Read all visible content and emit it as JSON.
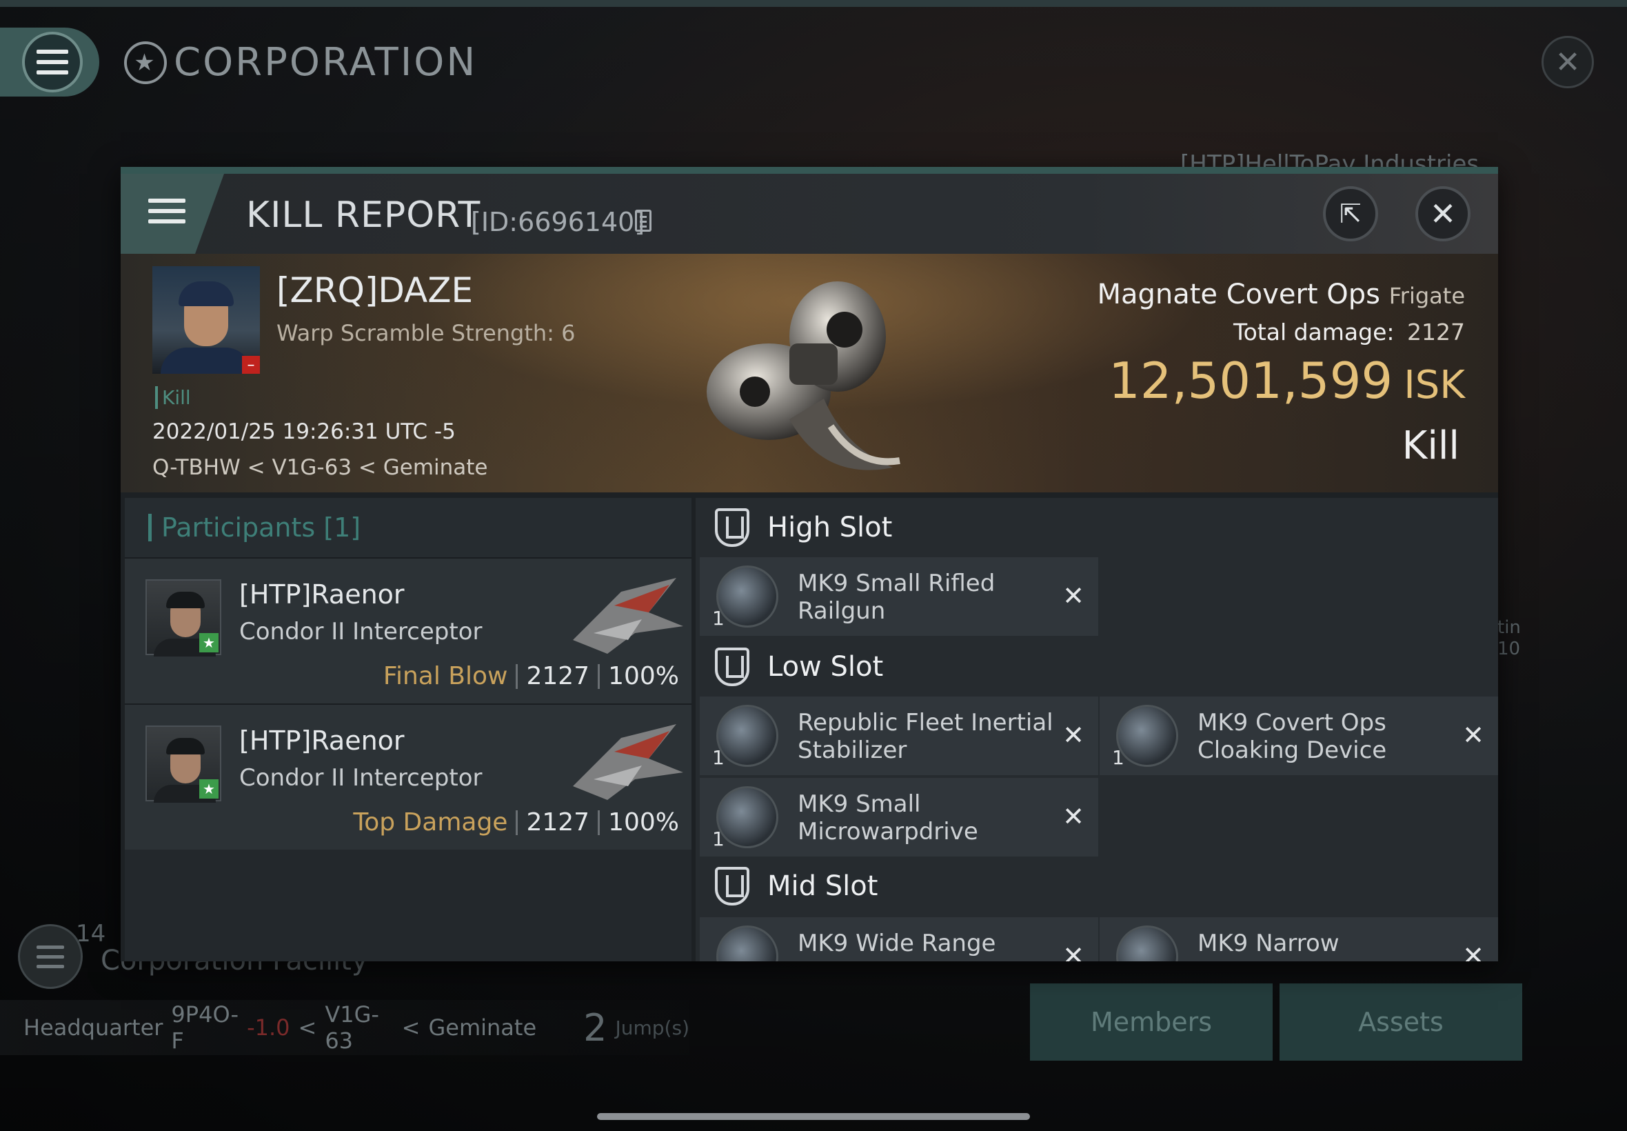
{
  "background": {
    "corp_title": "CORPORATION",
    "corp_name_partial": "[HTP]HellToPay Industries",
    "side_text_1": "tin",
    "side_text_2": "10",
    "facility_count": "14",
    "facility_label": "Corporation Facility",
    "hq": {
      "label": "Headquarter",
      "system": "9P4O-F",
      "security": "-1.0",
      "constellation": "V1G-63",
      "region": "Geminate",
      "sep": "<",
      "jumps": "2",
      "jumps_label": "Jump(s)"
    },
    "tabs": [
      {
        "label": "Members"
      },
      {
        "label": "Assets"
      }
    ]
  },
  "kill_report": {
    "title": "KILL REPORT",
    "id_label": "[ID:6696140]",
    "victim": {
      "name": "[ZRQ]DAZE",
      "warp_scramble": "Warp Scramble Strength: 6",
      "tag": "Kill",
      "datetime": "2022/01/25 19:26:31 UTC -5",
      "location": "Q-TBHW < V1G-63 < Geminate"
    },
    "ship": {
      "name": "Magnate Covert Ops",
      "class": "Frigate",
      "total_damage_label": "Total damage:",
      "total_damage": "2127",
      "isk_value": "12,501,599",
      "isk_unit": "ISK",
      "result": "Kill"
    },
    "participants": {
      "header": "Participants [1]",
      "rows": [
        {
          "name": "[HTP]Raenor",
          "ship": "Condor II Interceptor",
          "role": "Final Blow",
          "damage": "2127",
          "percent": "100%"
        },
        {
          "name": "[HTP]Raenor",
          "ship": "Condor II Interceptor",
          "role": "Top Damage",
          "damage": "2127",
          "percent": "100%"
        }
      ]
    },
    "slots": {
      "high": {
        "label": "High Slot",
        "items": [
          {
            "name": "MK9 Small Rifled Railgun",
            "qty": "1"
          }
        ]
      },
      "low": {
        "label": "Low Slot",
        "items": [
          {
            "name": "Republic Fleet Inertial Stabilizer",
            "qty": "1"
          },
          {
            "name": "MK9 Covert Ops Cloaking Device",
            "qty": "1"
          },
          {
            "name": "MK9 Small Microwarpdrive",
            "qty": "1"
          }
        ]
      },
      "mid": {
        "label": "Mid Slot",
        "items": [
          {
            "name": "MK9 Wide Range",
            "qty": ""
          },
          {
            "name": "MK9 Narrow",
            "qty": ""
          }
        ]
      }
    }
  },
  "icons": {
    "menu": "hamburger-icon",
    "close": "close-icon",
    "share": "share-icon",
    "copy": "copy-icon",
    "slot": "shield-icon",
    "remove": "x-icon"
  },
  "colors": {
    "accent_teal": "#3e7f78",
    "isk_gold": "#e5c17a",
    "role_gold": "#c9a25c",
    "security_red": "#7a2a2a"
  }
}
